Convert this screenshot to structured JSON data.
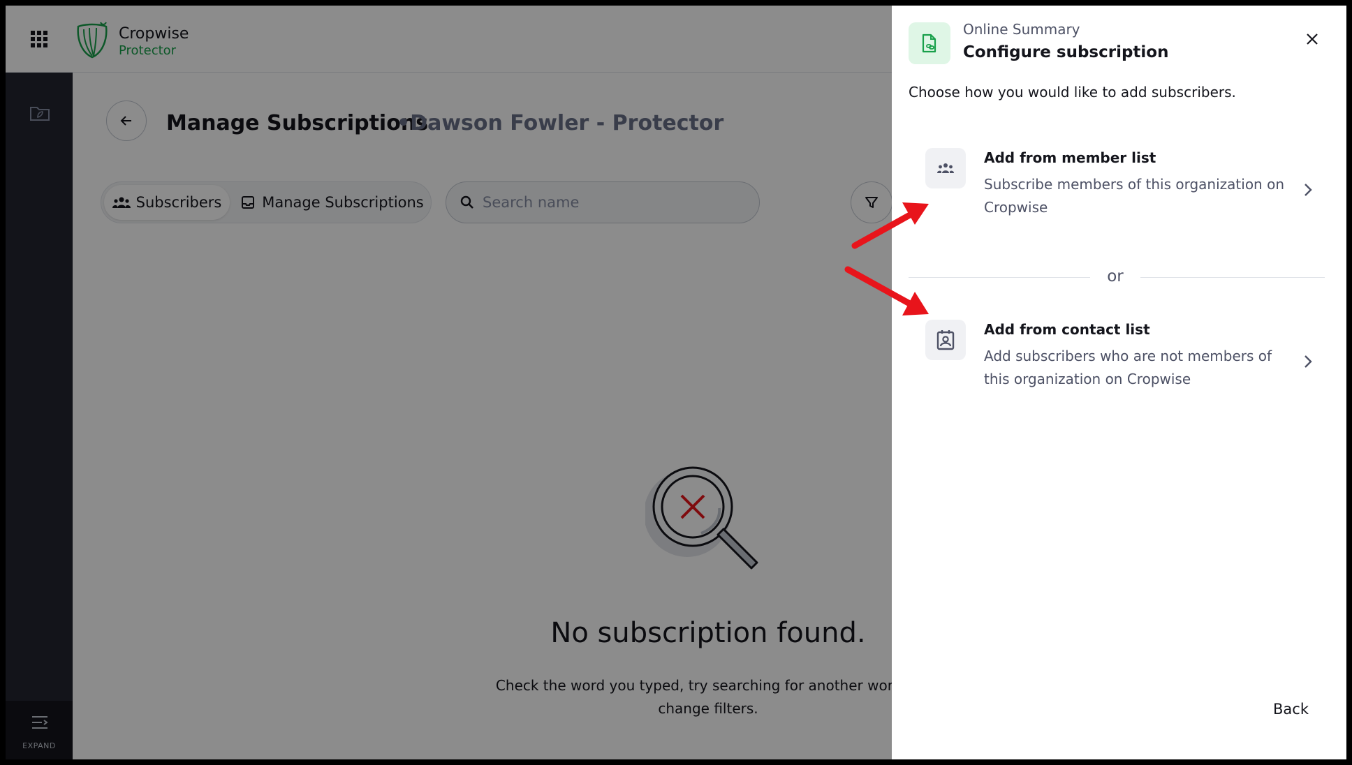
{
  "app": {
    "brand_name": "Cropwise",
    "brand_sub": "Protector"
  },
  "sidebar": {
    "expand_label": "EXPAND"
  },
  "page": {
    "title": "Manage Subscriptions",
    "subtitle": "•Dawson Fowler - Protector"
  },
  "tabs": [
    {
      "label": "Subscribers",
      "icon": "group-icon",
      "selected": true
    },
    {
      "label": "Manage Subscriptions",
      "icon": "inbox-icon",
      "selected": false
    }
  ],
  "search": {
    "placeholder": "Search name",
    "value": ""
  },
  "empty_state": {
    "title": "No subscription found.",
    "description": "Check the word you typed, try searching for another word or change filters."
  },
  "drawer": {
    "kicker": "Online Summary",
    "title": "Configure subscription",
    "instruction": "Choose how you would like to add subscribers.",
    "options": [
      {
        "title": "Add from member list",
        "description": "Subscribe members of this organization on Cropwise",
        "icon": "people-icon"
      },
      {
        "title": "Add from contact list",
        "description": "Add subscribers who are not members of this organization on Cropwise",
        "icon": "contact-card-icon"
      }
    ],
    "divider_label": "or",
    "back_label": "Back"
  },
  "colors": {
    "brand_green": "#19a04b",
    "annotation_red": "#e8141b",
    "sidebar_bg": "#232630"
  }
}
